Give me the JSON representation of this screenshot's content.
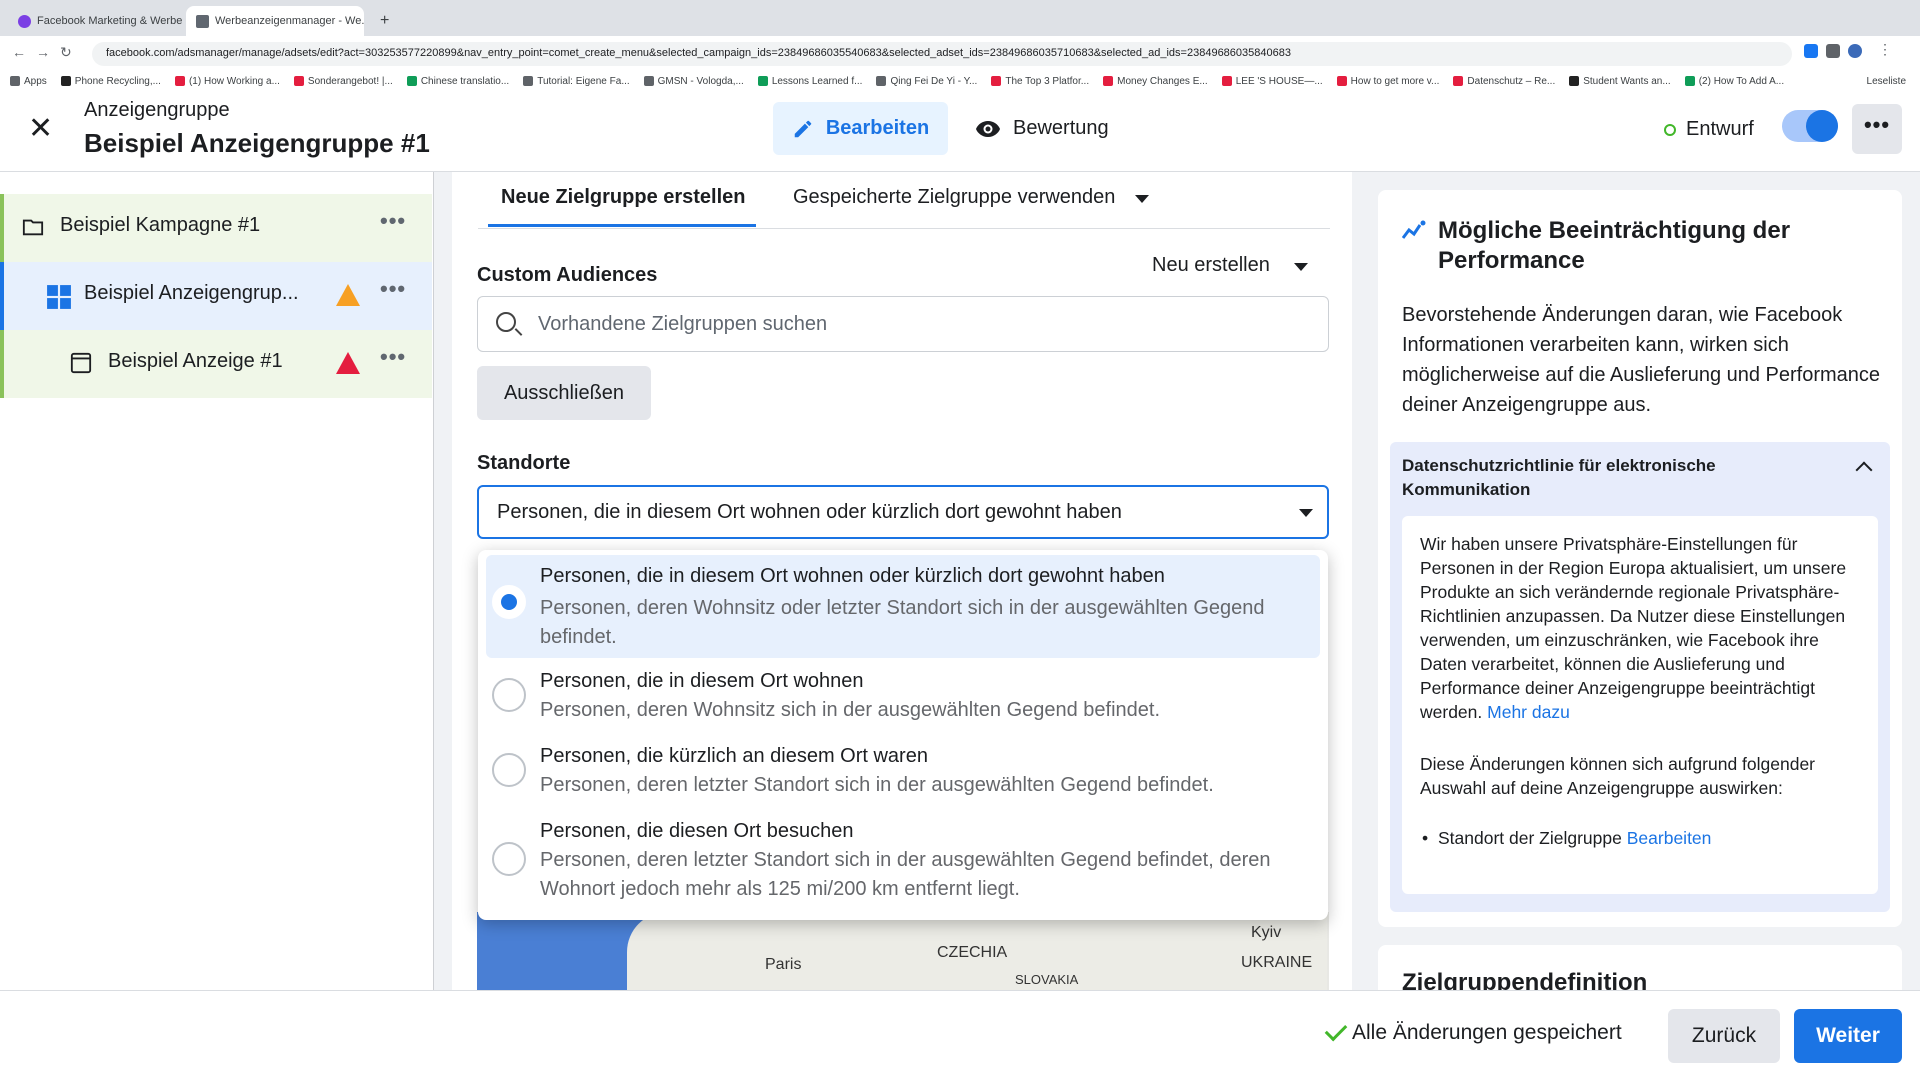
{
  "browser": {
    "tabs": [
      {
        "label": "Facebook Marketing & Werbe...",
        "active": false
      },
      {
        "label": "Werbeanzeigenmanager - We...",
        "active": true
      }
    ],
    "url": "facebook.com/adsmanager/manage/adsets/edit?act=303253577220899&nav_entry_point=comet_create_menu&selected_campaign_ids=23849686035540683&selected_adset_ids=23849686035710683&selected_ad_ids=23849686035840683",
    "bookmarks": [
      "Apps",
      "Phone Recycling,...",
      "(1) How Working a...",
      "Sonderangebot! |...",
      "Chinese translatio...",
      "Tutorial: Eigene Fa...",
      "GMSN - Vologda,...",
      "Lessons Learned f...",
      "Qing Fei De Yi - Y...",
      "The Top 3 Platfor...",
      "Money Changes E...",
      "LEE 'S HOUSE—...",
      "How to get more v...",
      "Datenschutz – Re...",
      "Student Wants an...",
      "(2) How To Add A..."
    ],
    "reading_list": "Leseliste"
  },
  "header": {
    "crumb": "Anzeigengruppe",
    "title": "Beispiel Anzeigengruppe #1",
    "edit_label": "Bearbeiten",
    "review_label": "Bewertung",
    "status_label": "Entwurf"
  },
  "tree": {
    "campaign": "Beispiel Kampagne #1",
    "adset": "Beispiel Anzeigengrup...",
    "ad": "Beispiel Anzeige #1"
  },
  "form": {
    "tab_new": "Neue Zielgruppe erstellen",
    "tab_saved": "Gespeicherte Zielgruppe verwenden",
    "custom_audiences_label": "Custom Audiences",
    "new_create": "Neu erstellen",
    "search_placeholder": "Vorhandene Zielgruppen suchen",
    "exclude_label": "Ausschließen",
    "locations_label": "Standorte",
    "location_selected": "Personen, die in diesem Ort wohnen oder kürzlich dort gewohnt haben",
    "map_labels": [
      "Paris",
      "CZECHIA",
      "SLOVAKIA",
      "Kyiv",
      "UKRAINE"
    ]
  },
  "dropdown": {
    "options": [
      {
        "title": "Personen, die in diesem Ort wohnen oder kürzlich dort gewohnt haben",
        "desc": "Personen, deren Wohnsitz oder letzter Standort sich in der ausgewählten Gegend befindet.",
        "selected": true
      },
      {
        "title": "Personen, die in diesem Ort wohnen",
        "desc": "Personen, deren Wohnsitz sich in der ausgewählten Gegend befindet.",
        "selected": false
      },
      {
        "title": "Personen, die kürzlich an diesem Ort waren",
        "desc": "Personen, deren letzter Standort sich in der ausgewählten Gegend befindet.",
        "selected": false
      },
      {
        "title": "Personen, die diesen Ort besuchen",
        "desc": "Personen, deren letzter Standort sich in der ausgewählten Gegend befindet, deren Wohnort jedoch mehr als 125 mi/200 km entfernt liegt.",
        "selected": false
      }
    ]
  },
  "right": {
    "title": "Mögliche Beeinträchtigung der Performance",
    "body": "Bevorstehende Änderungen daran, wie Facebook Informationen verarbeiten kann, wirken sich möglicherweise auf die Auslieferung und Performance deiner Anzeigengruppe aus.",
    "accordion_title": "Datenschutzrichtlinie für elektronische Kommunikation",
    "accordion_text": "Wir haben unsere Privatsphäre-Einstellungen für Personen in der Region Europa aktualisiert, um unsere Produkte an sich verändernde regionale Privatsphäre-Richtlinien anzupassen. Da Nutzer diese Einstellungen verwenden, um einzuschränken, wie Facebook ihre Daten verarbeitet, können die Auslieferung und Performance deiner Anzeigengruppe beeinträchtigt werden.",
    "more_link": "Mehr dazu",
    "accordion_text2": "Diese Änderungen können sich aufgrund folgender Auswahl auf deine Anzeigengruppe auswirken:",
    "bullet_text": "Standort der Zielgruppe",
    "bullet_link": "Bearbeiten",
    "next_section": "Zielgruppendefinition"
  },
  "footer": {
    "saved_label": "Alle Änderungen gespeichert",
    "back_label": "Zurück",
    "next_label": "Weiter"
  },
  "colors": {
    "accent": "#1b74e4",
    "warning": "#f7b928",
    "error": "#e41e3f",
    "success": "#42b72a"
  }
}
